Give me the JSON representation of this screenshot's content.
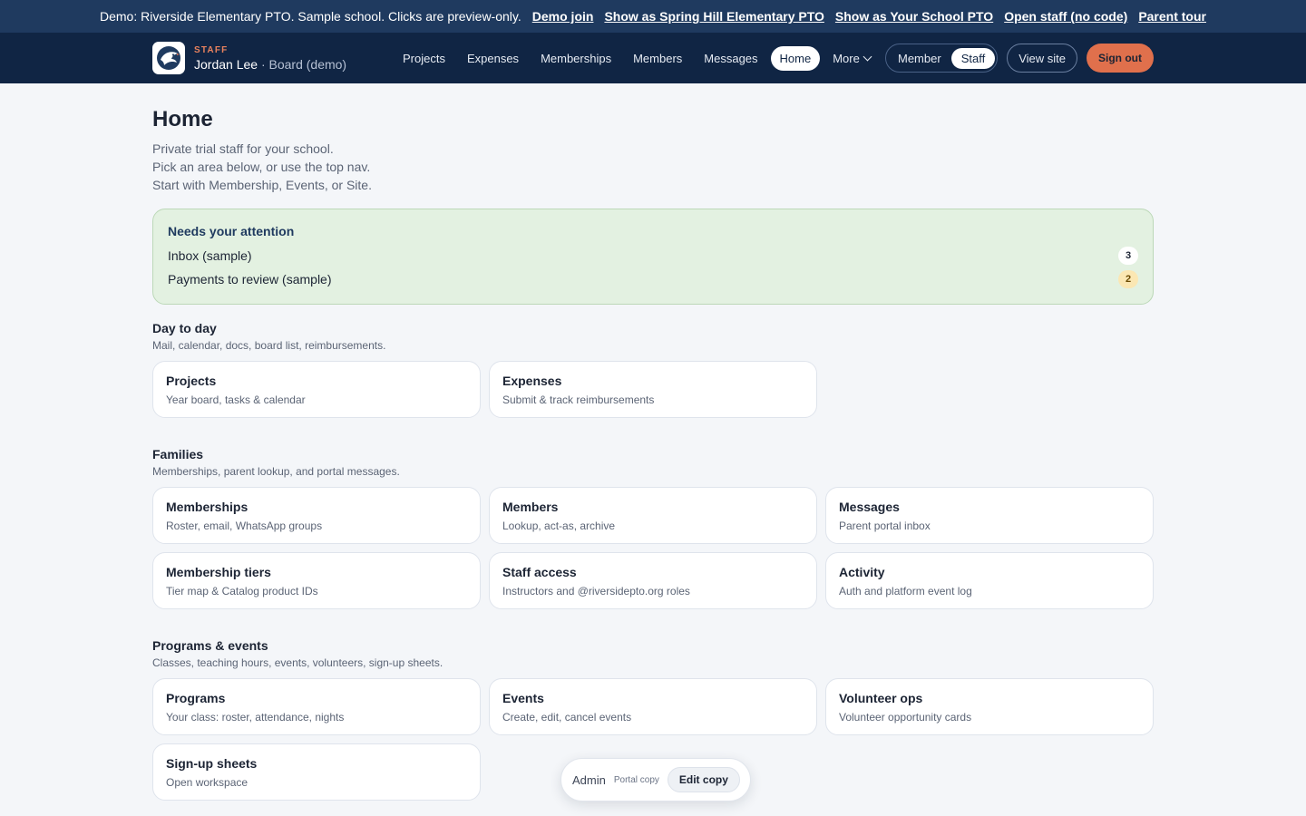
{
  "banner": {
    "message": "Demo: Riverside Elementary PTO. Sample school. Clicks are preview-only.",
    "links": [
      "Demo join",
      "Show as Spring Hill Elementary PTO",
      "Show as Your School PTO",
      "Open staff (no code)",
      "Parent tour"
    ]
  },
  "header": {
    "role": "STAFF",
    "user_name": "Jordan Lee",
    "user_role": " · Board (demo)",
    "logo_icon": "eagle-logo-icon",
    "nav": [
      "Projects",
      "Expenses",
      "Memberships",
      "Members",
      "Messages",
      "Home"
    ],
    "nav_active": "Home",
    "more_label": "More",
    "mode_toggle": [
      "Member",
      "Staff"
    ],
    "mode_active": "Staff",
    "view_site": "View site",
    "sign_out": "Sign out"
  },
  "page": {
    "title": "Home",
    "intro": [
      "Private trial staff for your school.",
      "Pick an area below, or use the top nav.",
      "Start with Membership, Events, or Site."
    ]
  },
  "attention": {
    "title": "Needs your attention",
    "items": [
      {
        "label": "Inbox (sample)",
        "count": "3"
      },
      {
        "label": "Payments to review (sample)",
        "count": "2"
      }
    ]
  },
  "sections": [
    {
      "title": "Day to day",
      "subtitle": "Mail, calendar, docs, board list, reimbursements.",
      "cards": [
        {
          "title": "Projects",
          "subtitle": "Year board, tasks & calendar"
        },
        {
          "title": "Expenses",
          "subtitle": "Submit & track reimbursements"
        }
      ]
    },
    {
      "title": "Families",
      "subtitle": "Memberships, parent lookup, and portal messages.",
      "cards": [
        {
          "title": "Memberships",
          "subtitle": "Roster, email, WhatsApp groups"
        },
        {
          "title": "Members",
          "subtitle": "Lookup, act-as, archive"
        },
        {
          "title": "Messages",
          "subtitle": "Parent portal inbox"
        },
        {
          "title": "Membership tiers",
          "subtitle": "Tier map & Catalog product IDs"
        },
        {
          "title": "Staff access",
          "subtitle": "Instructors and @riversidepto.org roles"
        },
        {
          "title": "Activity",
          "subtitle": "Auth and platform event log"
        }
      ]
    },
    {
      "title": "Programs & events",
      "subtitle": "Classes, teaching hours, events, volunteers, sign-up sheets.",
      "cards": [
        {
          "title": "Programs",
          "subtitle": "Your class: roster, attendance, nights"
        },
        {
          "title": "Events",
          "subtitle": "Create, edit, cancel events"
        },
        {
          "title": "Volunteer ops",
          "subtitle": "Volunteer opportunity cards"
        },
        {
          "title": "Sign-up sheets",
          "subtitle": "Open workspace"
        }
      ]
    }
  ],
  "admin_pill": {
    "label": "Admin",
    "sub": "Portal copy",
    "button": "Edit copy"
  },
  "colors": {
    "banner_bg": "#1f3a5f",
    "nav_bg": "#102544",
    "accent": "#e0704c",
    "attention_bg": "#e3f1e1"
  }
}
